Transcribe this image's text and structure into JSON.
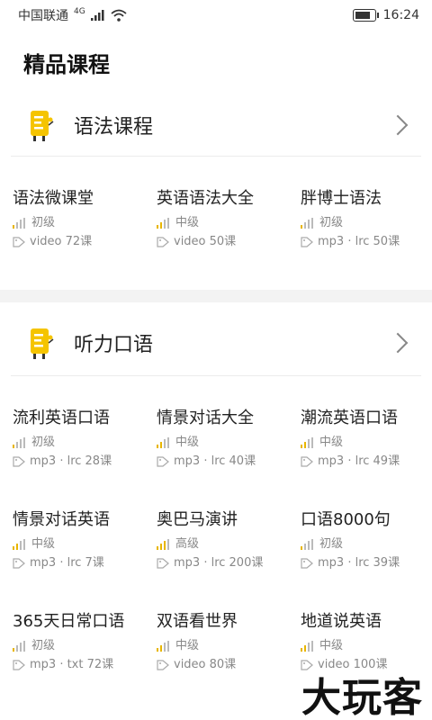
{
  "status": {
    "carrier": "中国联通",
    "network": "4G",
    "time": "16:24"
  },
  "page_title": "精品课程",
  "sections": [
    {
      "title": "语法课程",
      "courses": [
        {
          "name": "语法微课堂",
          "level": "初级",
          "tag": "video 72课"
        },
        {
          "name": "英语语法大全",
          "level": "中级",
          "tag": "video 50课"
        },
        {
          "name": "胖博士语法",
          "level": "初级",
          "tag": "mp3 · lrc 50课"
        }
      ]
    },
    {
      "title": "听力口语",
      "courses": [
        {
          "name": "流利英语口语",
          "level": "初级",
          "tag": "mp3 · lrc 28课"
        },
        {
          "name": "情景对话大全",
          "level": "中级",
          "tag": "mp3 · lrc 40课"
        },
        {
          "name": "潮流英语口语",
          "level": "中级",
          "tag": "mp3 · lrc 49课"
        },
        {
          "name": "情景对话英语",
          "level": "中级",
          "tag": "mp3 · lrc 7课"
        },
        {
          "name": "奥巴马演讲",
          "level": "高级",
          "tag": "mp3 · lrc 200课"
        },
        {
          "name": "口语8000句",
          "level": "初级",
          "tag": "mp3 · lrc 39课"
        },
        {
          "name": "365天日常口语",
          "level": "初级",
          "tag": "mp3 · txt 72课"
        },
        {
          "name": "双语看世界",
          "level": "中级",
          "tag": "video 80课"
        },
        {
          "name": "地道说英语",
          "level": "中级",
          "tag": "video 100课"
        }
      ]
    }
  ],
  "watermark": "大玩客",
  "colors": {
    "accent": "#e8b600",
    "muted": "#888888",
    "band": "#f3f3f3"
  }
}
